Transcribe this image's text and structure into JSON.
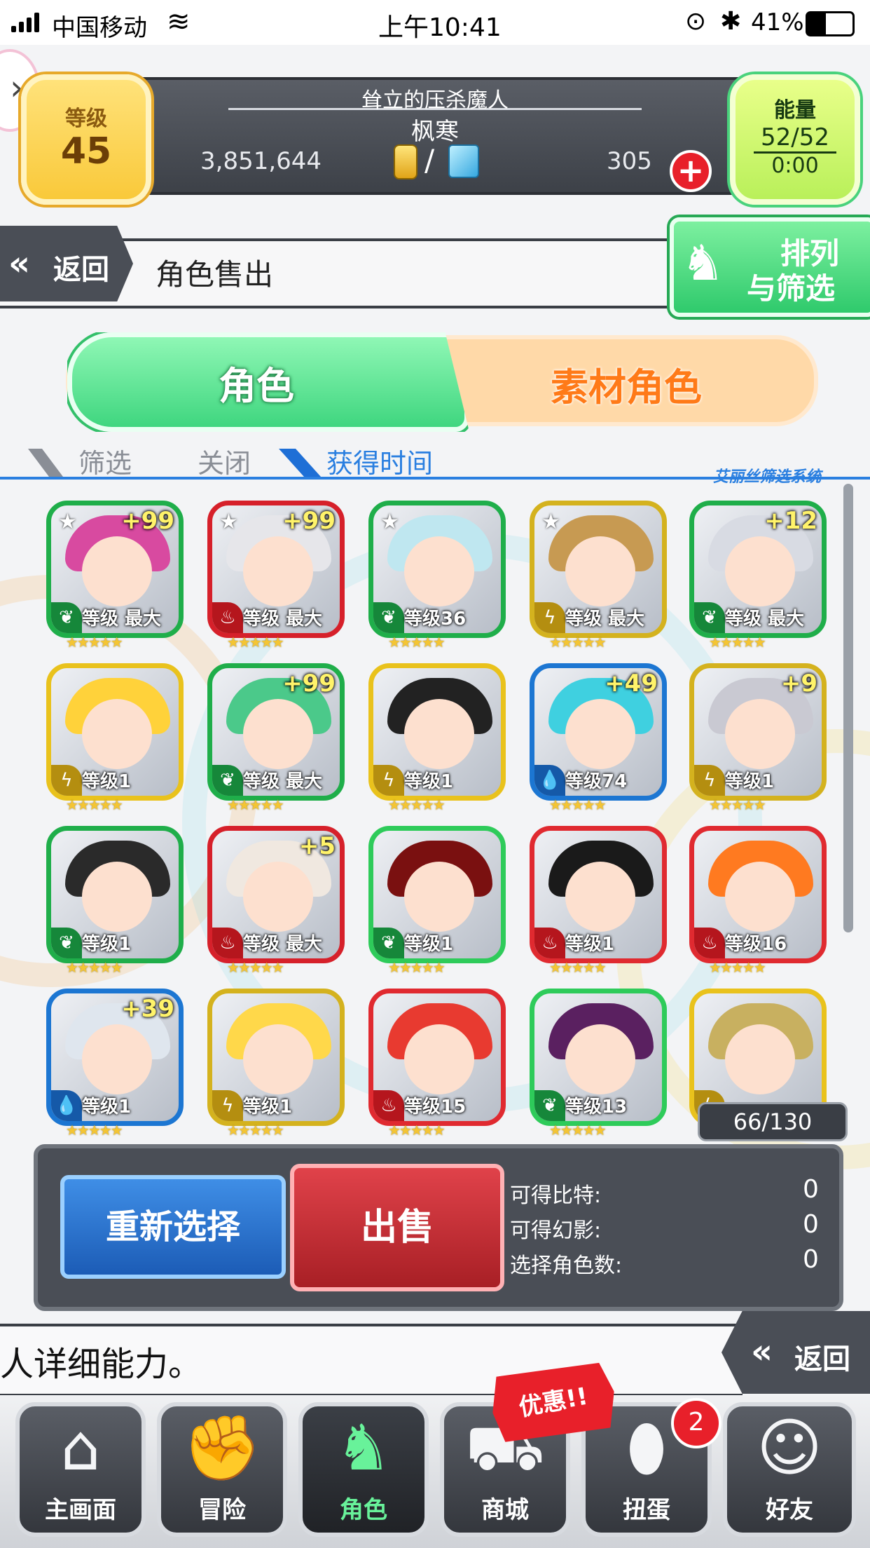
{
  "status_bar": {
    "carrier": "中国移动",
    "time": "上午10:41",
    "battery": "41%"
  },
  "header": {
    "level_label": "等级",
    "level": "45",
    "player_title": "耸立的压杀魔人",
    "player_name": "枫寒",
    "coins": "3,851,644",
    "separator": "/",
    "gems": "305",
    "energy_label": "能量",
    "energy": "52/52",
    "energy_timer": "0:00"
  },
  "subheader": {
    "back_label": "返回",
    "page_title": "角色售出",
    "sort_label_1": "排列",
    "sort_label_2": "与筛选"
  },
  "tabs": [
    {
      "label": "角色",
      "active": true
    },
    {
      "label": "素材角色",
      "active": false
    }
  ],
  "filter": {
    "label": "筛选",
    "value": "关闭",
    "sort": "获得时间",
    "system": "艾丽丝筛选系统"
  },
  "characters": [
    {
      "plus": "+99",
      "level": "等级 最大",
      "fav": true,
      "frame": "#1fae4a",
      "element": "wood"
    },
    {
      "plus": "+99",
      "level": "等级 最大",
      "fav": true,
      "frame": "#d6202a",
      "element": "fire"
    },
    {
      "plus": "",
      "level": "等级36",
      "fav": true,
      "frame": "#1fae4a",
      "element": "wood"
    },
    {
      "plus": "",
      "level": "等级 最大",
      "fav": true,
      "frame": "#d4b21e",
      "element": "light"
    },
    {
      "plus": "+12",
      "level": "等级 最大",
      "fav": false,
      "frame": "#1fae4a",
      "element": "wood"
    },
    {
      "plus": "",
      "level": "等级1",
      "fav": false,
      "frame": "#e9c21c",
      "element": "light"
    },
    {
      "plus": "+99",
      "level": "等级 最大",
      "fav": false,
      "frame": "#1fae4a",
      "element": "wood"
    },
    {
      "plus": "",
      "level": "等级1",
      "fav": false,
      "frame": "#e9c21c",
      "element": "light"
    },
    {
      "plus": "+49",
      "level": "等级74",
      "fav": false,
      "frame": "#1c76d2",
      "element": "water"
    },
    {
      "plus": "+9",
      "level": "等级1",
      "fav": false,
      "frame": "#d4b21e",
      "element": "light"
    },
    {
      "plus": "",
      "level": "等级1",
      "fav": false,
      "frame": "#1fae4a",
      "element": "wood"
    },
    {
      "plus": "+5",
      "level": "等级 最大",
      "fav": false,
      "frame": "#d6202a",
      "element": "fire"
    },
    {
      "plus": "",
      "level": "等级1",
      "fav": false,
      "frame": "#2ecb5a",
      "element": "wood"
    },
    {
      "plus": "",
      "level": "等级1",
      "fav": false,
      "frame": "#e02a30",
      "element": "fire"
    },
    {
      "plus": "",
      "level": "等级16",
      "fav": false,
      "frame": "#e02a30",
      "element": "fire"
    },
    {
      "plus": "+39",
      "level": "等级1",
      "fav": false,
      "frame": "#1c76d2",
      "element": "water"
    },
    {
      "plus": "",
      "level": "等级1",
      "fav": false,
      "frame": "#d4b21e",
      "element": "light"
    },
    {
      "plus": "",
      "level": "等级15",
      "fav": false,
      "frame": "#e02a30",
      "element": "fire"
    },
    {
      "plus": "",
      "level": "等级13",
      "fav": false,
      "frame": "#2ecb5a",
      "element": "wood"
    },
    {
      "plus": "",
      "level": "",
      "fav": false,
      "frame": "#e9c21c",
      "element": "light"
    }
  ],
  "box_count": "66/130",
  "panel": {
    "reselect_label": "重新选择",
    "sell_label": "出售",
    "bits_label": "可得比特:",
    "bits_value": "0",
    "phantom_label": "可得幻影:",
    "phantom_value": "0",
    "selected_label": "选择角色数:",
    "selected_value": "0"
  },
  "message": {
    "text": "人详细能力。",
    "back_label": "返回"
  },
  "nav": {
    "items": [
      {
        "label": "主画面",
        "icon": "home-icon"
      },
      {
        "label": "冒险",
        "icon": "handshake-icon"
      },
      {
        "label": "角色",
        "icon": "rabbit-icon"
      },
      {
        "label": "商城",
        "icon": "cart-icon"
      },
      {
        "label": "扭蛋",
        "icon": "egg-icon"
      },
      {
        "label": "好友",
        "icon": "friends-icon"
      }
    ],
    "gacha_badge": "2",
    "promo": "优惠!!"
  }
}
